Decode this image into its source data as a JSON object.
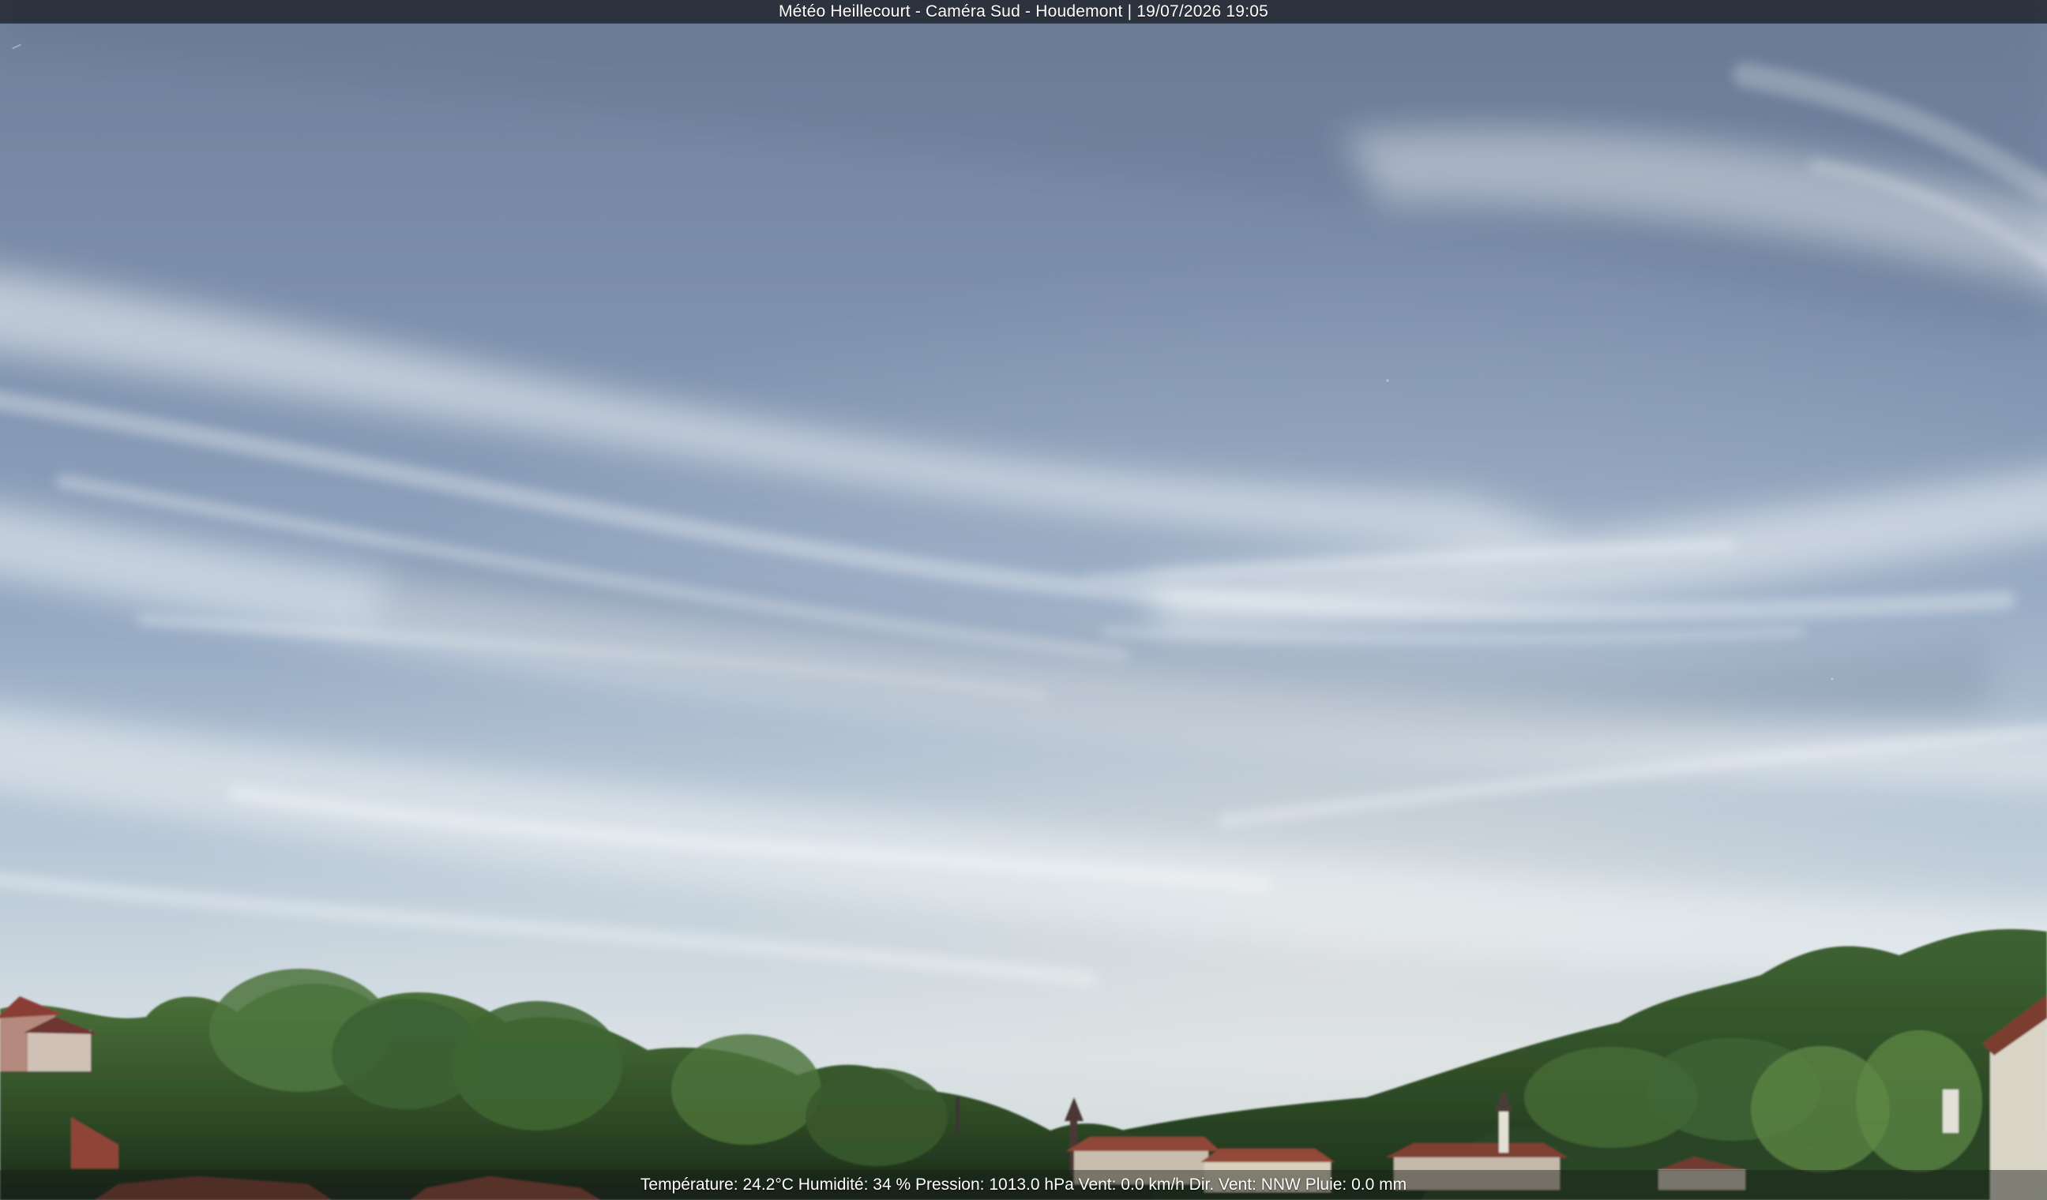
{
  "overlay": {
    "title": "Météo Heillecourt - Caméra Sud - Houdemont | 19/07/2026 19:05",
    "readings": "Température: 24.2°C  Humidité: 34 % Pression: 1013.0 hPa Vent: 0.0 km/h Dir. Vent: NNW Pluie: 0.0 mm"
  },
  "scene": {
    "icon": "webcam-sky-landscape",
    "colors": {
      "sky_top": "#6f7f9a",
      "sky_middle": "#91a7c1",
      "sky_horizon": "#d8e0e4",
      "trees": "#314d2b",
      "roofs": "#9b4a3a"
    }
  }
}
